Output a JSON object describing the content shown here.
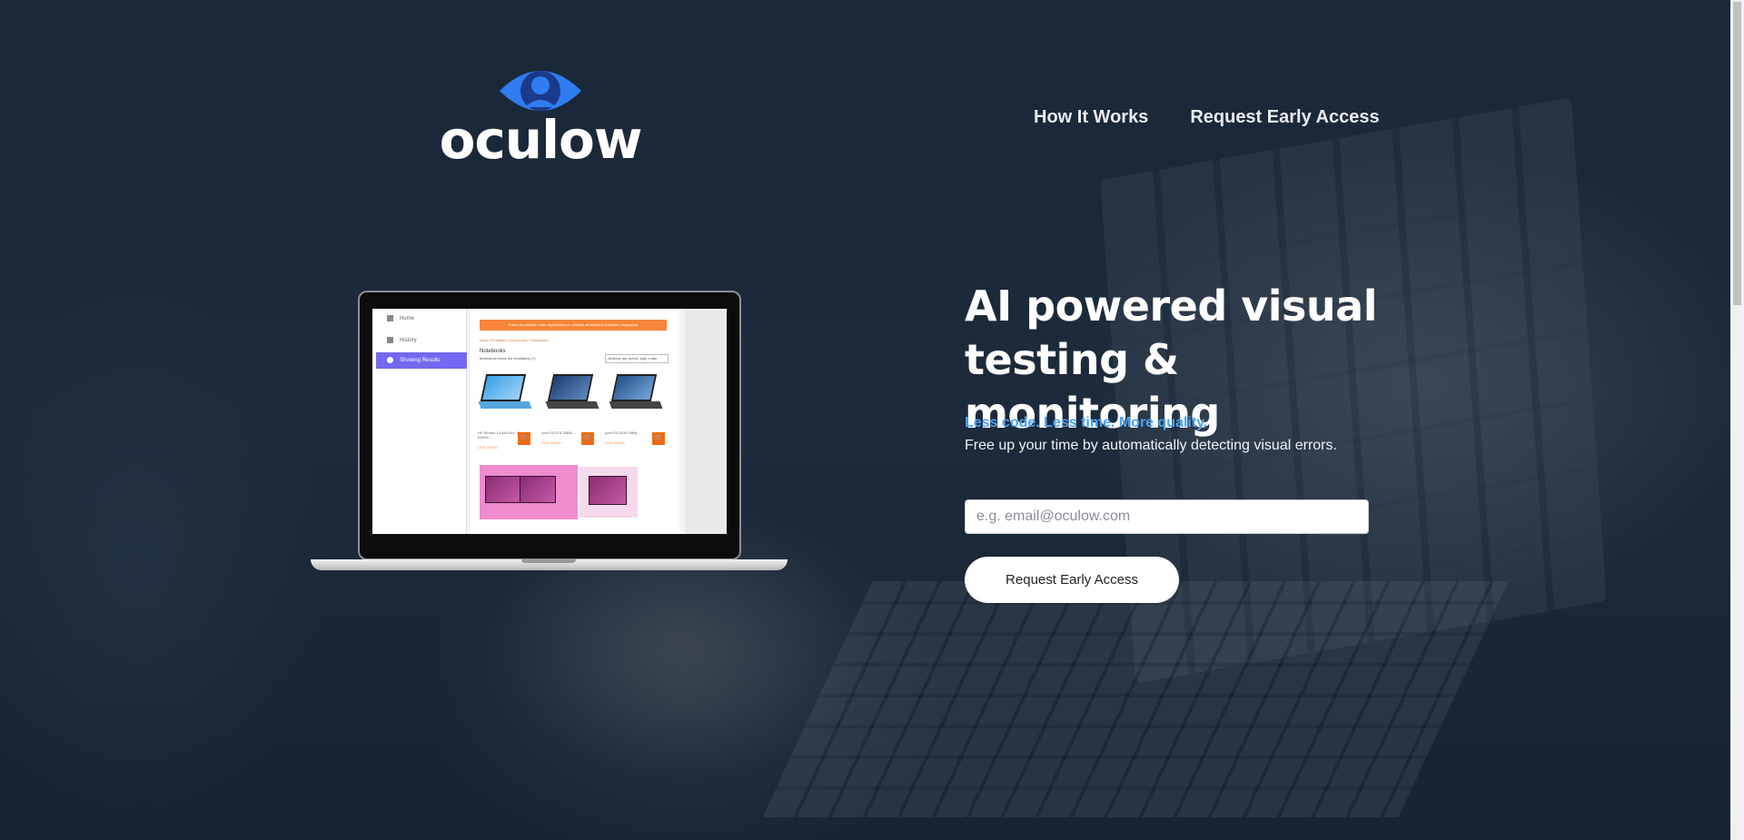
{
  "brand": {
    "name": "oculow"
  },
  "nav": {
    "items": [
      {
        "label": "How It Works"
      },
      {
        "label": "Request Early Access"
      }
    ]
  },
  "hero": {
    "headline_line1": "AI powered visual",
    "headline_line2": "testing & monitoring",
    "tagline": "Less code. Less time. More quality.",
    "description": "Free up your time by automatically detecting visual errors.",
    "email_placeholder": "e.g. email@oculow.com",
    "email_value": "",
    "cta_label": "Request Early Access"
  },
  "mockup": {
    "sidebar": [
      {
        "label": "Home"
      },
      {
        "label": "History"
      },
      {
        "label": "Showing Results"
      }
    ],
    "banner": "Todos los precios están expresados en dólares americanos (Dólares Uruguayos)",
    "breadcrumb": "Inicio / Portátiles y Accesorios / Notebooks",
    "title": "Notebooks",
    "subtitle": "Mostrando todos los resultados (7)",
    "sort_label": "Ordenar por precio: bajo a alto",
    "products": [
      {
        "name": "HP Stream 14-ax010nr 14in N3060 ...",
        "price": "USS 270,00"
      },
      {
        "name": "Acer E5-575-33BM ...",
        "price": "USS 399,00"
      },
      {
        "name": "Acer E5-523G-98by ...",
        "price": "USS 549,00"
      }
    ]
  },
  "colors": {
    "accent": "#4aa4f0",
    "logo_blue": "#2f7bf0",
    "logo_dark": "#1c3a8a",
    "cart_orange": "#f26a12"
  }
}
